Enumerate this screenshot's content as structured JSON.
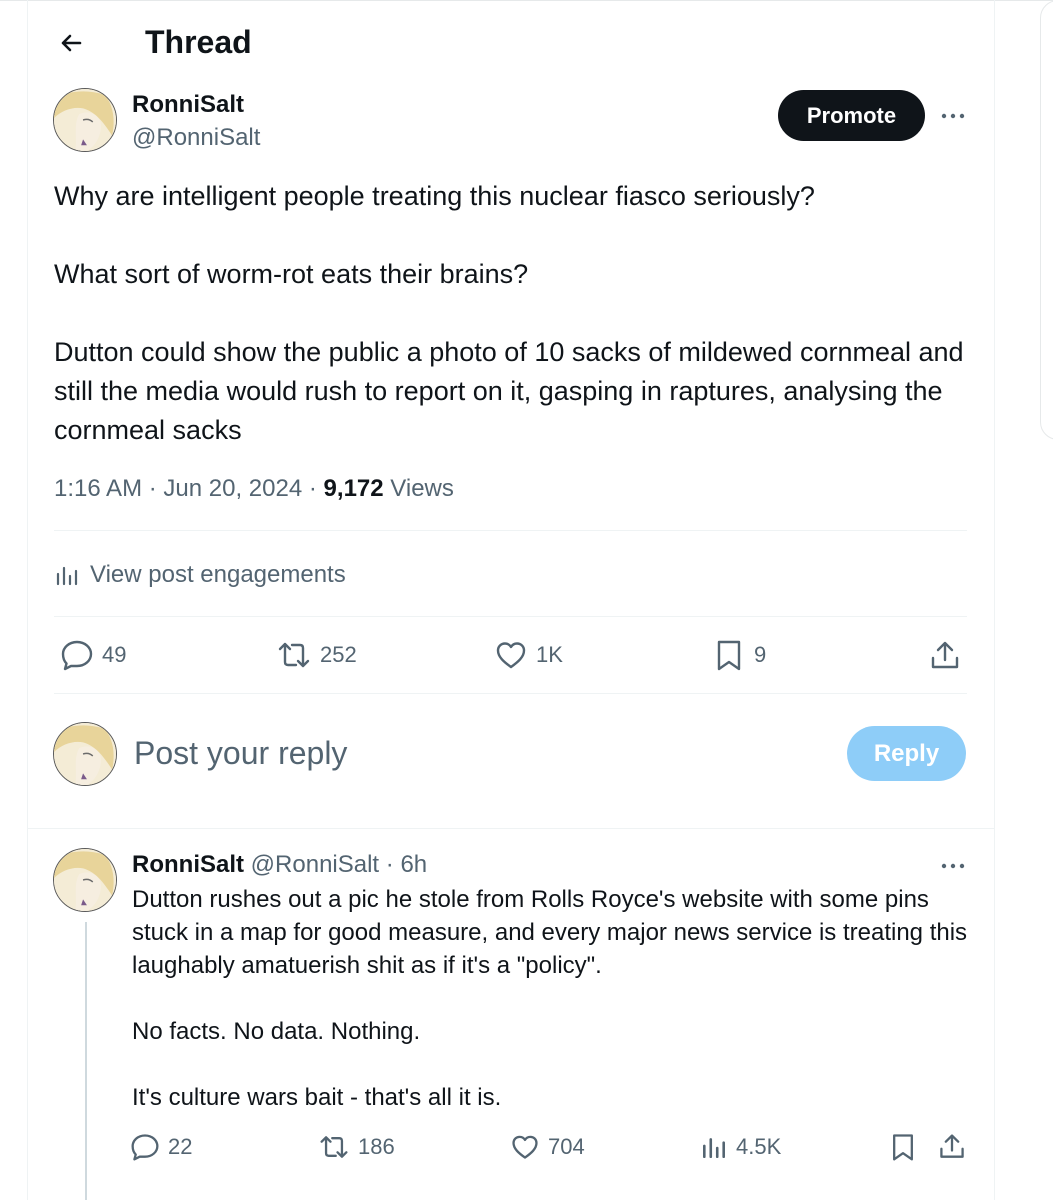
{
  "header": {
    "title": "Thread"
  },
  "post": {
    "author_name": "RonniSalt",
    "author_handle": "@RonniSalt",
    "promote_label": "Promote",
    "text": [
      "Why are intelligent people treating this nuclear fiasco seriously?",
      "What sort of worm-rot eats their brains?",
      "Dutton could show the public a photo of 10 sacks of mildewed cornmeal and still the media would rush to report on it, gasping in raptures, analysing the cornmeal sacks"
    ],
    "time": "1:16 AM",
    "sep1": "·",
    "date": "Jun 20, 2024",
    "sep2": "·",
    "views_count": "9,172",
    "views_label": "Views",
    "engagements_label": "View post engagements",
    "actions": {
      "replies": "49",
      "reposts": "252",
      "likes": "1K",
      "bookmarks": "9"
    }
  },
  "composer": {
    "placeholder": "Post your reply",
    "reply_label": "Reply"
  },
  "reply": {
    "author_name": "RonniSalt",
    "author_handle": "@RonniSalt",
    "sep": "·",
    "time": "6h",
    "text": [
      "Dutton rushes out a pic he stole from Rolls Royce's website with some pins stuck in a map for good measure, and every major news service is treating this laughably amatuerish shit as if it's a \"policy\".",
      "No facts. No data. Nothing.",
      "It's culture wars bait - that's all it is."
    ],
    "actions": {
      "replies": "22",
      "reposts": "186",
      "likes": "704",
      "views": "4.5K"
    }
  },
  "colors": {
    "text_primary": "#0f1419",
    "text_secondary": "#536471",
    "reply_button_disabled": "#8ecdf8",
    "divider": "#eff3f4"
  },
  "icons": [
    "back-arrow-icon",
    "more-icon",
    "analytics-icon",
    "reply-icon",
    "repost-icon",
    "like-icon",
    "bookmark-icon",
    "share-icon",
    "views-icon"
  ]
}
